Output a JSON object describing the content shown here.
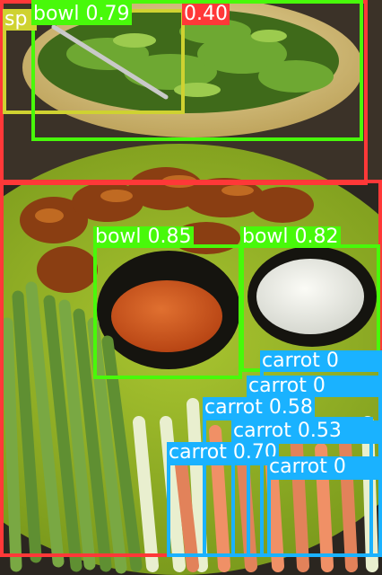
{
  "detections": [
    {
      "label": "bowl 0.79",
      "class": "bowl",
      "confidence": 0.79,
      "color": "#48f90a"
    },
    {
      "label": "sp",
      "class": "spoon",
      "color": "#cfd231"
    },
    {
      "label": "0.40",
      "class": "dining table",
      "confidence": 0.4,
      "color": "#ff3838"
    },
    {
      "label": "bowl 0.85",
      "class": "bowl",
      "confidence": 0.85,
      "color": "#48f90a"
    },
    {
      "label": "bowl 0.82",
      "class": "bowl",
      "confidence": 0.82,
      "color": "#48f90a"
    },
    {
      "label": "carrot 0.58",
      "class": "carrot",
      "confidence": 0.58,
      "color": "#1ab2ff"
    },
    {
      "label": "carrot 0.70",
      "class": "carrot",
      "confidence": 0.7,
      "color": "#1ab2ff"
    },
    {
      "label": "carrot 0",
      "class": "carrot",
      "color": "#1ab2ff"
    },
    {
      "label": "carrot 0",
      "class": "carrot",
      "color": "#1ab2ff"
    },
    {
      "label": "carrot 0.53",
      "class": "carrot",
      "color": "#1ab2ff"
    },
    {
      "label": "carrot 0",
      "class": "carrot",
      "color": "#1ab2ff"
    }
  ]
}
